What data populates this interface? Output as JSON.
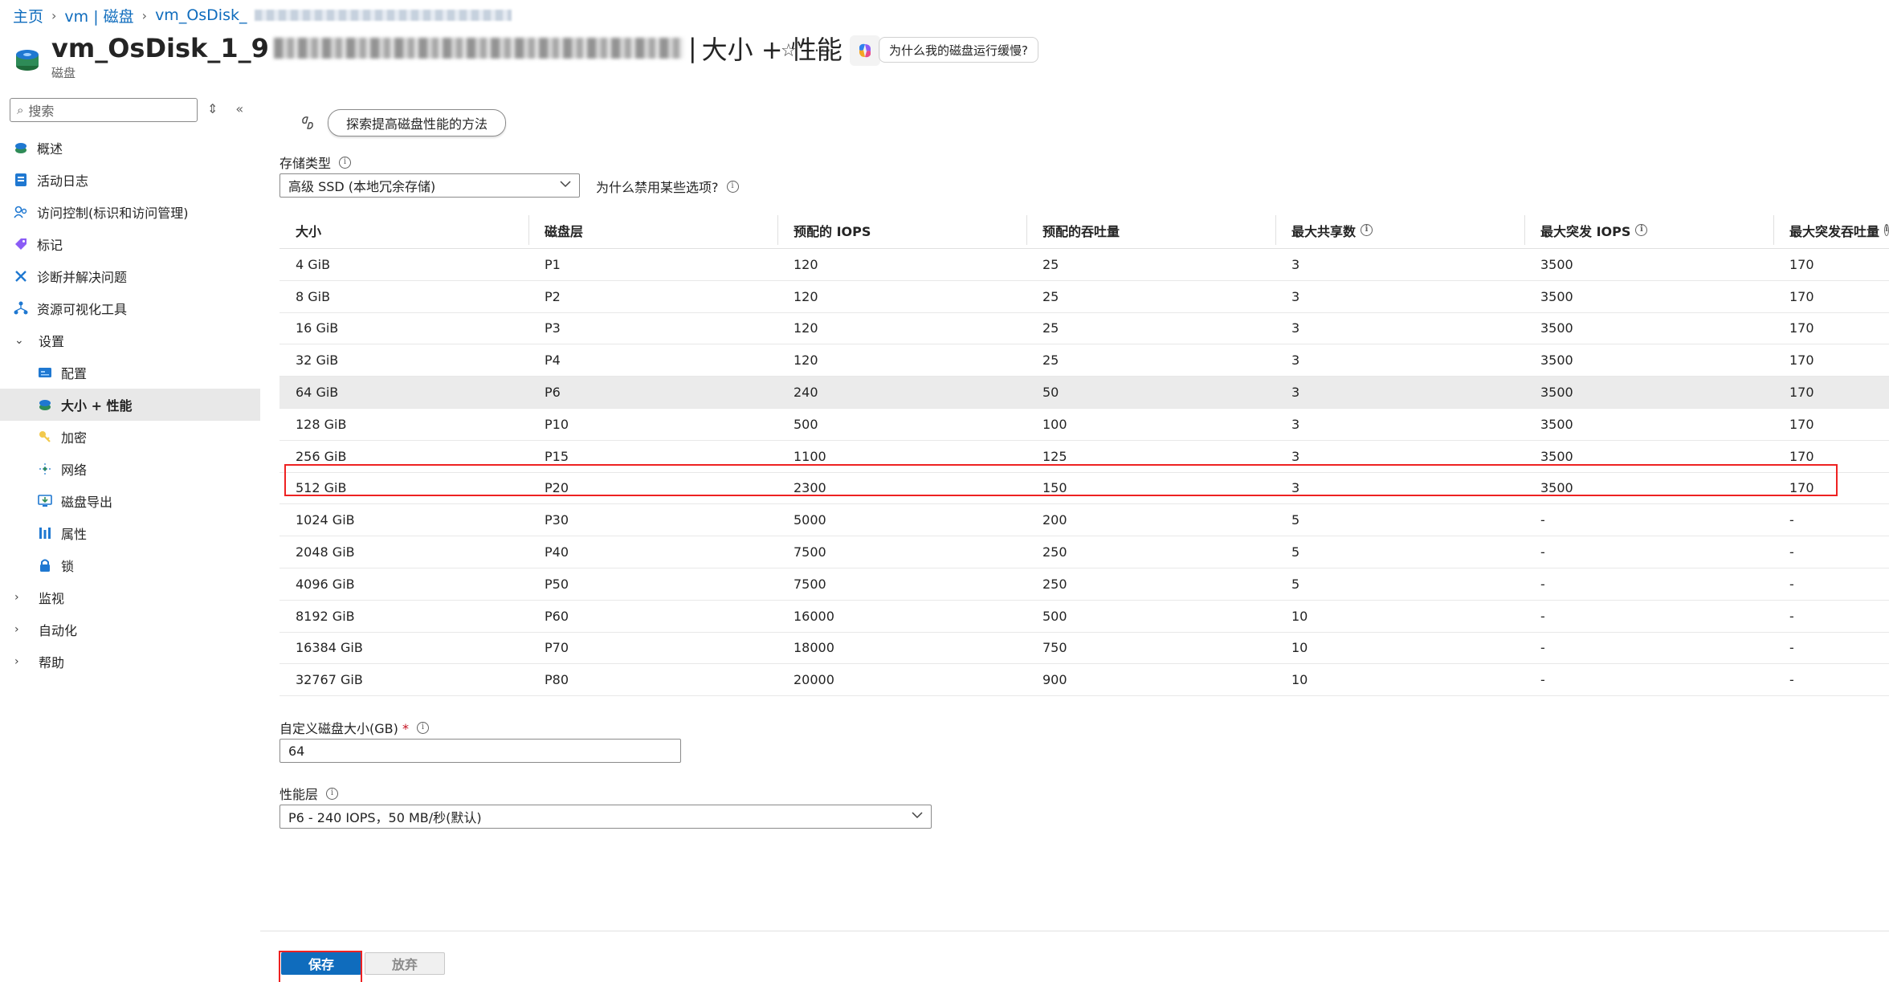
{
  "breadcrumb": {
    "items": [
      "主页",
      "vm | 磁盘",
      "vm_OsDisk_"
    ]
  },
  "header": {
    "title_prefix": "vm_OsDisk_1_9",
    "title_sep": "|",
    "page_name": "大小 + 性能",
    "subtitle": "磁盘",
    "ask_button": "为什么我的磁盘运行缓慢?"
  },
  "sidebar": {
    "search_placeholder": "搜索",
    "items": [
      {
        "label": "概述",
        "icon": "disk-icon"
      },
      {
        "label": "活动日志",
        "icon": "activity-log-icon"
      },
      {
        "label": "访问控制(标识和访问管理)",
        "icon": "people-icon"
      },
      {
        "label": "标记",
        "icon": "tag-icon"
      },
      {
        "label": "诊断并解决问题",
        "icon": "wrench-icon"
      },
      {
        "label": "资源可视化工具",
        "icon": "hierarchy-icon"
      }
    ],
    "settings_group": "设置",
    "settings_items": [
      {
        "label": "配置",
        "icon": "config-icon"
      },
      {
        "label": "大小 + 性能",
        "icon": "disk-icon"
      },
      {
        "label": "加密",
        "icon": "key-icon"
      },
      {
        "label": "网络",
        "icon": "network-icon"
      },
      {
        "label": "磁盘导出",
        "icon": "export-icon"
      },
      {
        "label": "属性",
        "icon": "properties-icon"
      },
      {
        "label": "锁",
        "icon": "lock-icon"
      }
    ],
    "groups": [
      "监视",
      "自动化",
      "帮助"
    ]
  },
  "main": {
    "explore_button": "探索提高磁盘性能的方法",
    "storage_type_label": "存储类型",
    "storage_type_value": "高级 SSD (本地冗余存储)",
    "why_disabled": "为什么禁用某些选项?",
    "table": {
      "headers": [
        "大小",
        "磁盘层",
        "预配的 IOPS",
        "预配的吞吐量",
        "最大共享数",
        "最大突发 IOPS",
        "最大突发吞吐量"
      ],
      "rows": [
        [
          "4 GiB",
          "P1",
          "120",
          "25",
          "3",
          "3500",
          "170"
        ],
        [
          "8 GiB",
          "P2",
          "120",
          "25",
          "3",
          "3500",
          "170"
        ],
        [
          "16 GiB",
          "P3",
          "120",
          "25",
          "3",
          "3500",
          "170"
        ],
        [
          "32 GiB",
          "P4",
          "120",
          "25",
          "3",
          "3500",
          "170"
        ],
        [
          "64 GiB",
          "P6",
          "240",
          "50",
          "3",
          "3500",
          "170"
        ],
        [
          "128 GiB",
          "P10",
          "500",
          "100",
          "3",
          "3500",
          "170"
        ],
        [
          "256 GiB",
          "P15",
          "1100",
          "125",
          "3",
          "3500",
          "170"
        ],
        [
          "512 GiB",
          "P20",
          "2300",
          "150",
          "3",
          "3500",
          "170"
        ],
        [
          "1024 GiB",
          "P30",
          "5000",
          "200",
          "5",
          "-",
          "-"
        ],
        [
          "2048 GiB",
          "P40",
          "7500",
          "250",
          "5",
          "-",
          "-"
        ],
        [
          "4096 GiB",
          "P50",
          "7500",
          "250",
          "5",
          "-",
          "-"
        ],
        [
          "8192 GiB",
          "P60",
          "16000",
          "500",
          "10",
          "-",
          "-"
        ],
        [
          "16384 GiB",
          "P70",
          "18000",
          "750",
          "10",
          "-",
          "-"
        ],
        [
          "32767 GiB",
          "P80",
          "20000",
          "900",
          "10",
          "-",
          "-"
        ]
      ],
      "selected_row": 4
    },
    "custom_size_label": "自定义磁盘大小(GB)",
    "required_mark": "*",
    "custom_size_value": "64",
    "perf_tier_label": "性能层",
    "perf_tier_value": "P6 - 240 IOPS，50 MB/秒(默认)"
  },
  "footer": {
    "save_label": "保存",
    "discard_label": "放弃"
  },
  "colors": {
    "accent": "#0f6cbd",
    "highlight_border": "#ee2222",
    "selected_row_bg": "#ebebeb"
  }
}
